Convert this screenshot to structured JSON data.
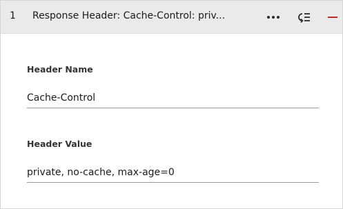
{
  "rule": {
    "index": "1",
    "title": "Response Header: Cache-Control: priv...",
    "icons": {
      "more": "more-horizontal-icon",
      "reorder": "reorder-icon",
      "remove": "minus-icon"
    },
    "remove_color": "#c62828"
  },
  "form": {
    "header_name_label": "Header Name",
    "header_name_value": "Cache-Control",
    "header_value_label": "Header Value",
    "header_value_value": "private, no-cache, max-age=0"
  }
}
